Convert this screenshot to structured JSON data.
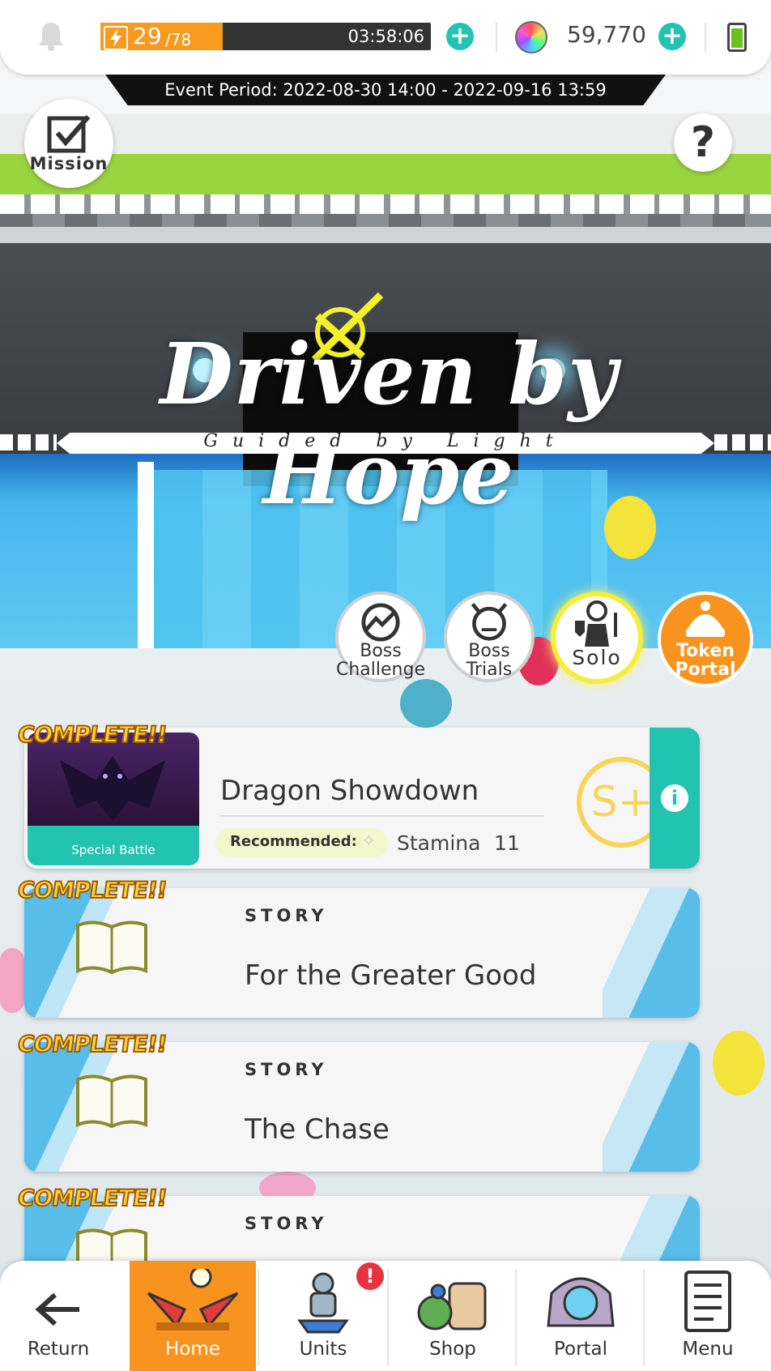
{
  "header": {
    "stamina_current": "29",
    "stamina_max": "/78",
    "stamina_fraction": 0.37,
    "timer": "03:58:06",
    "gems": "59,770"
  },
  "event": {
    "period": "Event Period: 2022-08-30 14:00 - 2022-09-16 13:59",
    "title": "Driven by Hope",
    "subtitle": "Guided by Light"
  },
  "buttons": {
    "mission": "Mission",
    "help": "?"
  },
  "modes": [
    {
      "line1": "Boss",
      "line2": "Challenge"
    },
    {
      "line1": "Boss Trials",
      "line2": ""
    },
    {
      "line1": "Solo",
      "line2": ""
    },
    {
      "line1": "Token",
      "line2": "Portal"
    }
  ],
  "quests": {
    "complete_label": "COMPLETE!!",
    "battle": {
      "tag": "Special Battle",
      "title": "Dragon Showdown",
      "recommended": "Recommended:",
      "stamina_label": "Stamina",
      "stamina_value": "11",
      "rank": "S+"
    },
    "stories": [
      {
        "tag": "STORY",
        "title": "For the Greater Good"
      },
      {
        "tag": "STORY",
        "title": "The Chase"
      },
      {
        "tag": "STORY",
        "title": ""
      }
    ]
  },
  "nav": {
    "return": "Return",
    "home": "Home",
    "units": "Units",
    "shop": "Shop",
    "portal": "Portal",
    "menu": "Menu",
    "units_badge": "!"
  },
  "colors": {
    "accent_teal": "#23c3b1",
    "stamina_orange": "#f79a1e",
    "home_orange": "#f7931e",
    "story_blue": "#58bde8",
    "complete_gold": "#ffd43b"
  }
}
